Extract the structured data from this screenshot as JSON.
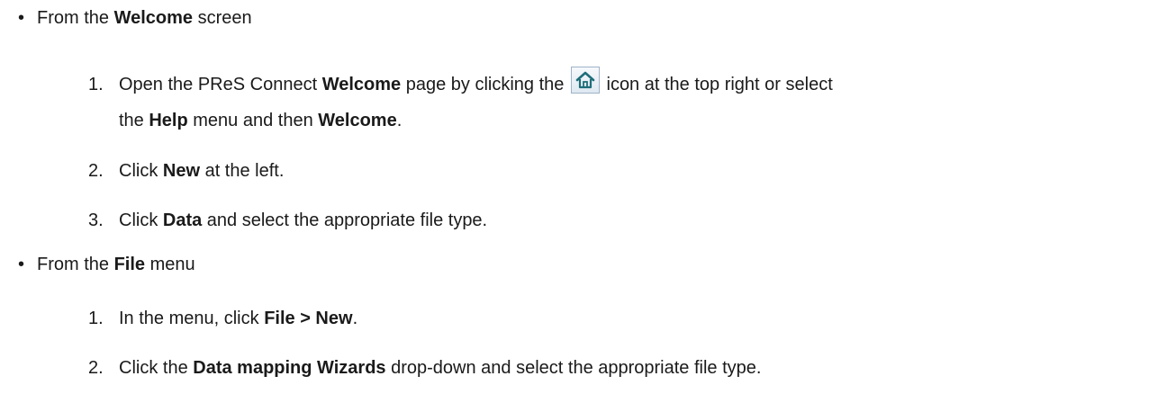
{
  "section1": {
    "lead": "From the ",
    "bold": "Welcome",
    "tail": " screen",
    "steps": [
      {
        "num": "1.",
        "parts": [
          "Open the PReS Connect ",
          "Welcome",
          " page by clicking the ",
          " icon at the top right or select",
          "the ",
          "Help",
          " menu and then ",
          "Welcome",
          "."
        ]
      },
      {
        "num": "2.",
        "parts": [
          "Click ",
          "New",
          " at the left."
        ]
      },
      {
        "num": "3.",
        "parts": [
          "Click ",
          "Data",
          " and select the appropriate file type."
        ]
      }
    ]
  },
  "section2": {
    "lead": "From the ",
    "bold": "File",
    "tail": " menu",
    "steps": [
      {
        "num": "1.",
        "parts": [
          "In the menu, click ",
          "File > New",
          "."
        ]
      },
      {
        "num": "2.",
        "parts": [
          "Click the ",
          "Data mapping Wizards",
          " drop-down and select the appropriate file type."
        ]
      }
    ]
  },
  "icons": {
    "bullet": "•",
    "home": "home-icon"
  },
  "colors": {
    "home_icon": "#1f6e7a"
  }
}
